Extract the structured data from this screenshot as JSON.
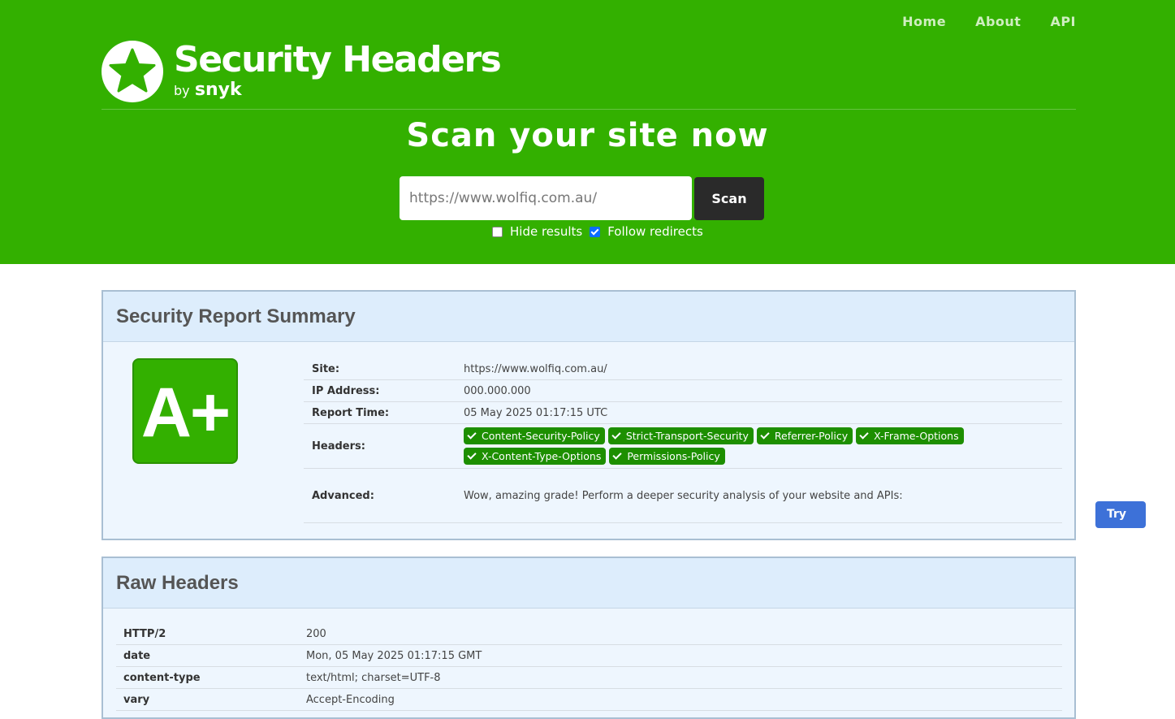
{
  "nav": {
    "home": "Home",
    "about": "About",
    "api": "API"
  },
  "logo": {
    "title": "Security Headers",
    "by": "by",
    "brand": "snyk"
  },
  "hero": {
    "title": "Scan your site now",
    "url_value": "https://www.wolfiq.com.au/",
    "scan_label": "Scan",
    "hide_results_label": "Hide results",
    "hide_results_checked": false,
    "follow_redirects_label": "Follow redirects",
    "follow_redirects_checked": true
  },
  "summary": {
    "heading": "Security Report Summary",
    "grade": "A+",
    "site_label": "Site:",
    "site": "https://www.wolfiq.com.au/",
    "ip_label": "IP Address:",
    "ip": "000.000.000",
    "time_label": "Report Time:",
    "time": "05 May 2025 01:17:15 UTC",
    "headers_label": "Headers:",
    "headers": [
      "Content-Security-Policy",
      "Strict-Transport-Security",
      "Referrer-Policy",
      "X-Frame-Options",
      "X-Content-Type-Options",
      "Permissions-Policy"
    ],
    "advanced_label": "Advanced:",
    "advanced_text": "Wow, amazing grade! Perform a deeper security analysis of your website and APIs:",
    "try_label": "Try Now"
  },
  "raw": {
    "heading": "Raw Headers",
    "rows": [
      {
        "k": "HTTP/2",
        "v": "200"
      },
      {
        "k": "date",
        "v": "Mon, 05 May 2025 01:17:15 GMT"
      },
      {
        "k": "content-type",
        "v": "text/html; charset=UTF-8"
      },
      {
        "k": "vary",
        "v": "Accept-Encoding"
      }
    ]
  },
  "colors": {
    "brand_green": "#33b000",
    "badge_green": "#1d8f00",
    "try_blue": "#3d71d8"
  }
}
